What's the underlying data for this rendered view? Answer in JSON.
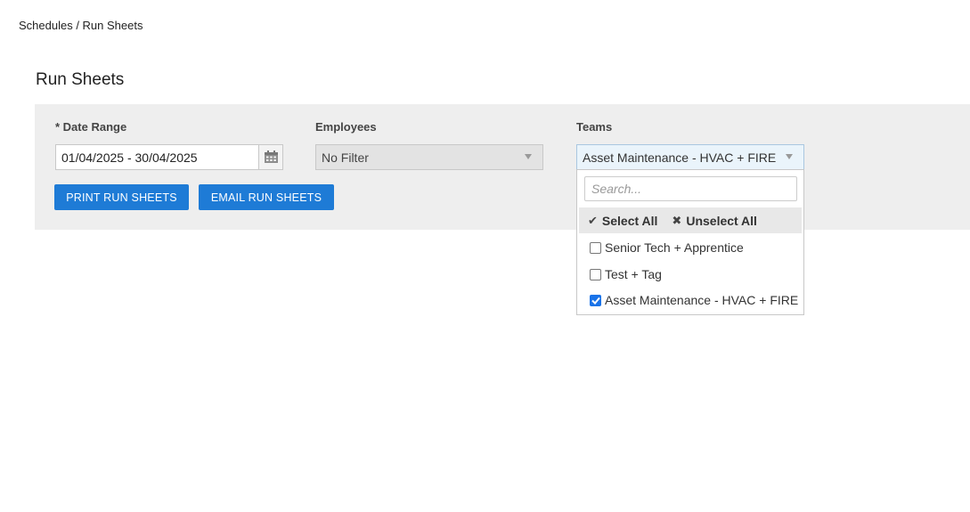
{
  "breadcrumb": "Schedules / Run Sheets",
  "page_title": "Run Sheets",
  "filters": {
    "date_range": {
      "label": "* Date Range",
      "value": "01/04/2025 - 30/04/2025"
    },
    "employees": {
      "label": "Employees",
      "value": "No Filter"
    },
    "teams": {
      "label": "Teams",
      "value": "Asset Maintenance - HVAC + FIRE"
    }
  },
  "buttons": {
    "print": "PRINT RUN SHEETS",
    "email": "EMAIL RUN SHEETS"
  },
  "teams_dropdown": {
    "search_placeholder": "Search...",
    "select_all": "Select All",
    "unselect_all": "Unselect All",
    "options": [
      {
        "label": "Senior Tech + Apprentice",
        "checked": false
      },
      {
        "label": "Test + Tag",
        "checked": false
      },
      {
        "label": "Asset Maintenance - HVAC + FIRE",
        "checked": true
      }
    ]
  },
  "colors": {
    "primary_button": "#1e7bd6",
    "checkbox_checked": "#1a73e8",
    "panel_bg": "#eeeeee"
  }
}
